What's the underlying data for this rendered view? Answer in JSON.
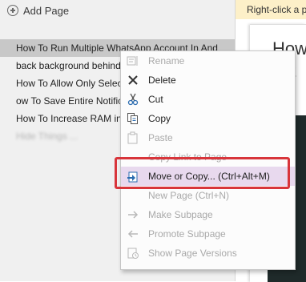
{
  "toolbar": {
    "add_page_label": "Add Page"
  },
  "hint_bar": {
    "text": "Right-click a p"
  },
  "pages": [
    {
      "title": "How To Run Multiple WhatsApp Account In And",
      "selected": true
    },
    {
      "title": "back background behind"
    },
    {
      "title": "How To Allow Only Selec"
    },
    {
      "title": "ow To Save Entire Notific"
    },
    {
      "title": "How To Increase RAM in"
    },
    {
      "title": "Hide Things ..."
    }
  ],
  "page_view": {
    "title_partial": "How…\nset"
  },
  "context_menu": {
    "items": [
      {
        "label": "Rename",
        "icon": "rename-icon",
        "disabled": true
      },
      {
        "label": "Delete",
        "icon": "delete-x-icon",
        "disabled": false
      },
      {
        "label": "Cut",
        "icon": "scissors-icon",
        "disabled": false
      },
      {
        "label": "Copy",
        "icon": "copy-icon",
        "disabled": false
      },
      {
        "label": "Paste",
        "icon": "paste-icon",
        "disabled": true
      },
      {
        "label": "Copy Link to Page",
        "icon": "link-icon",
        "disabled": true
      },
      {
        "label": "Move or Copy...  (Ctrl+Alt+M)",
        "icon": "move-copy-icon",
        "disabled": false,
        "highlighted": true
      },
      {
        "label": "New Page  (Ctrl+N)",
        "icon": "new-page-icon",
        "disabled": true
      },
      {
        "label": "Make Subpage",
        "icon": "arrow-right-icon",
        "disabled": true
      },
      {
        "label": "Promote Subpage",
        "icon": "arrow-left-icon",
        "disabled": true
      },
      {
        "label": "Show Page Versions",
        "icon": "page-versions-icon",
        "disabled": true
      }
    ]
  },
  "colors": {
    "highlight_border": "#d8353b",
    "menu_highlight": "#e8d9ee",
    "hint_bar": "#fdf0c8"
  }
}
